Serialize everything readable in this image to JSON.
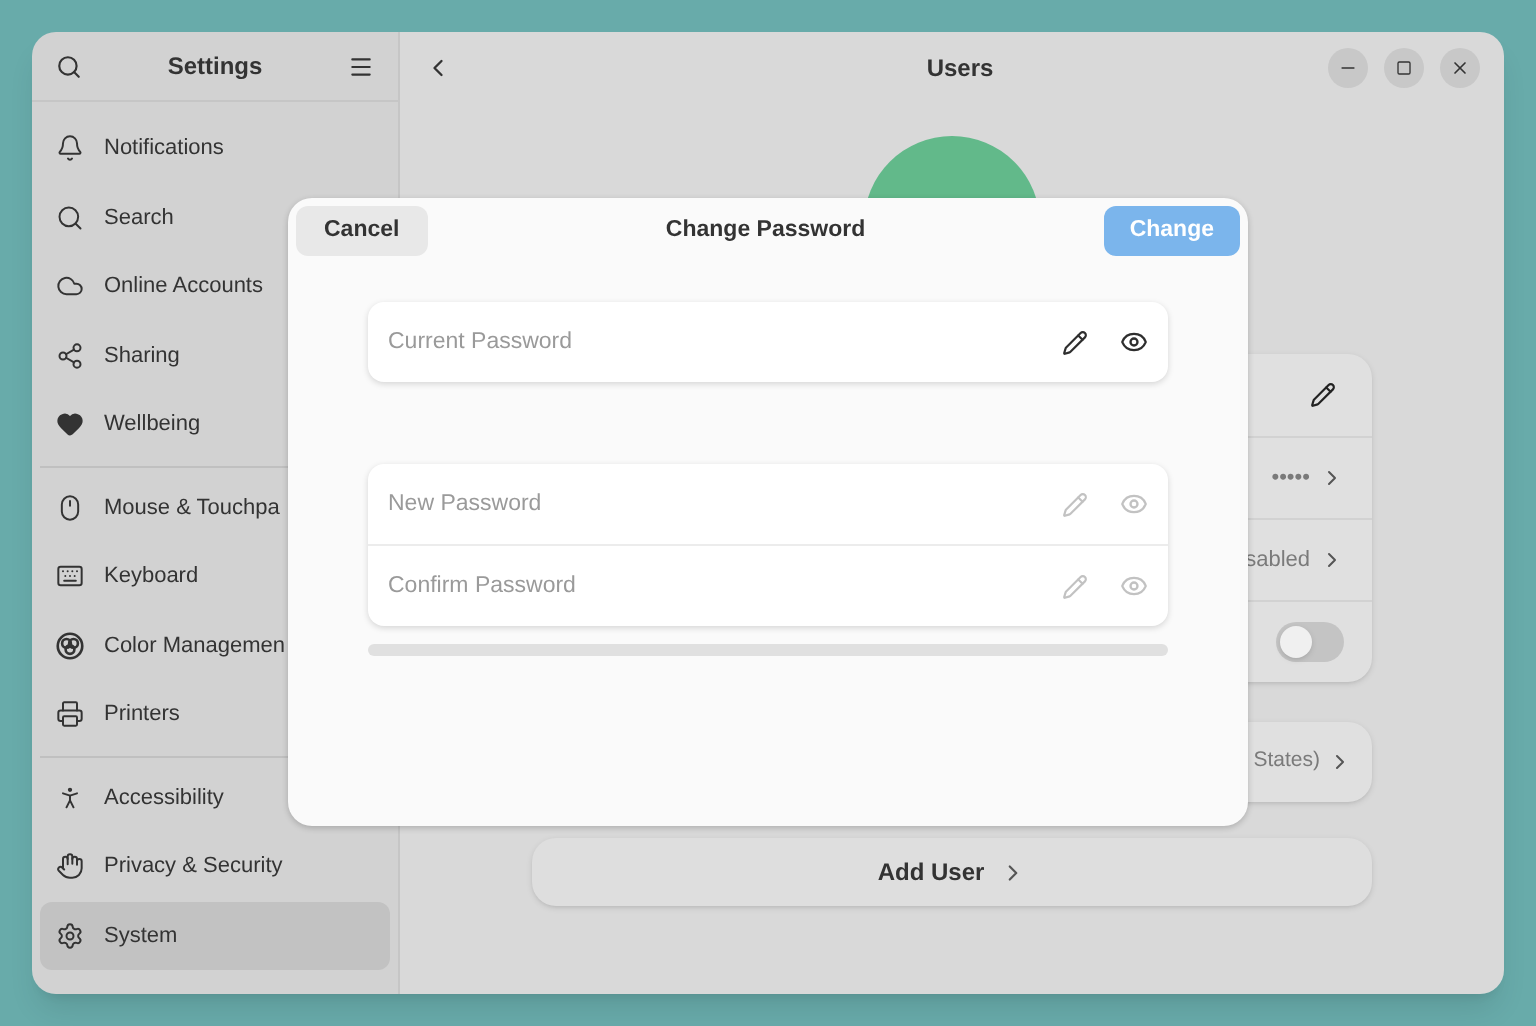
{
  "window": {
    "sidebar_title": "Settings",
    "title": "Users"
  },
  "sidebar": {
    "sections": [
      {
        "items": [
          {
            "label": "Notifications",
            "selected": false
          },
          {
            "label": "Search",
            "selected": false
          },
          {
            "label": "Online Accounts",
            "selected": false
          },
          {
            "label": "Sharing",
            "selected": false
          },
          {
            "label": "Wellbeing",
            "selected": false
          }
        ]
      },
      {
        "items": [
          {
            "label": "Mouse & Touchpa",
            "selected": false
          },
          {
            "label": "Keyboard",
            "selected": false
          },
          {
            "label": "Color Managemen",
            "selected": false
          },
          {
            "label": "Printers",
            "selected": false
          }
        ]
      },
      {
        "items": [
          {
            "label": "Accessibility",
            "selected": false
          },
          {
            "label": "Privacy & Security",
            "selected": false
          },
          {
            "label": "System",
            "selected": true
          }
        ]
      }
    ]
  },
  "user_rows": [
    {
      "kind": "edit"
    },
    {
      "kind": "value",
      "value": "•••••"
    },
    {
      "kind": "value",
      "value": "sabled"
    },
    {
      "kind": "toggle",
      "on": false
    }
  ],
  "language_row": {
    "value": "States)"
  },
  "add_user_button": "Add User",
  "dialog": {
    "title": "Change Password",
    "cancel": "Cancel",
    "confirm": {
      "label": "Change",
      "disabled": true
    },
    "current": {
      "placeholder": "Current Password",
      "disabled": false
    },
    "new_fields": [
      {
        "placeholder": "New Password",
        "disabled": true
      },
      {
        "placeholder": "Confirm Password",
        "disabled": true
      }
    ],
    "strength": {
      "level": 0
    }
  }
}
